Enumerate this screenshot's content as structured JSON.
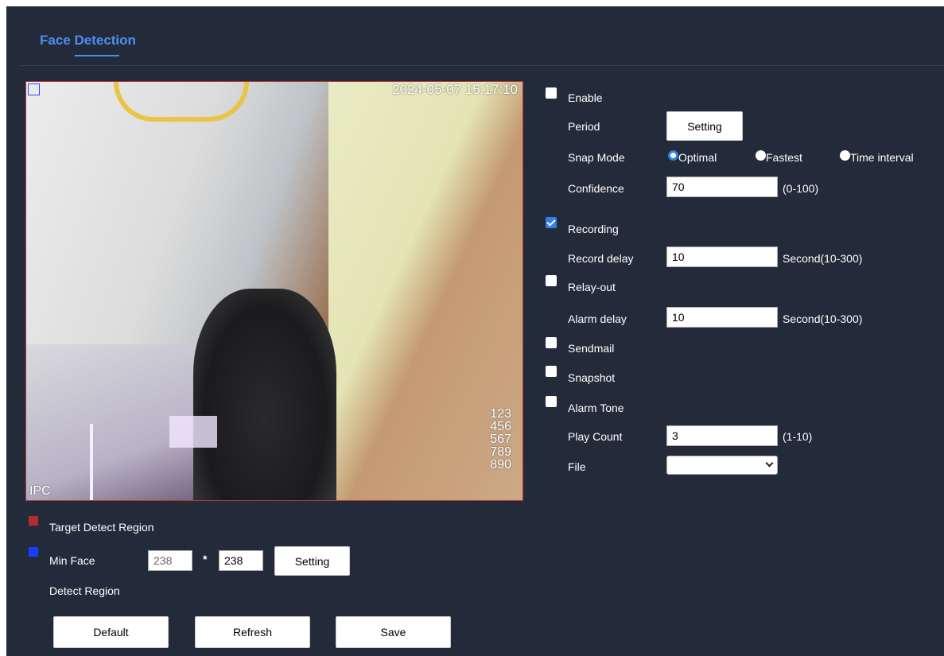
{
  "tab": {
    "label": "Face Detection"
  },
  "video": {
    "timestamp": "2024-05-07 15:17:10",
    "osd_lines": [
      "123",
      "456",
      "567",
      "789",
      "890"
    ],
    "channel_label": "IPC"
  },
  "legend": {
    "target_label": "Target Detect Region",
    "target_color": "#b32d2d",
    "min_face_color": "#1a3cff",
    "min_face_label": "Min Face",
    "detect_region_label": "Detect Region",
    "min_face_width": "238",
    "separator": "*",
    "min_face_height": "238",
    "setting_label": "Setting"
  },
  "footer": {
    "default_label": "Default",
    "refresh_label": "Refresh",
    "save_label": "Save"
  },
  "settings": {
    "enable": {
      "label": "Enable",
      "checked": false
    },
    "period": {
      "label": "Period",
      "button": "Setting"
    },
    "snap_mode": {
      "label": "Snap Mode",
      "options": [
        "Optimal",
        "Fastest",
        "Time interval"
      ],
      "selected": "Optimal"
    },
    "confidence": {
      "label": "Confidence",
      "value": "70",
      "range": "(0-100)"
    },
    "recording": {
      "label": "Recording",
      "checked": true
    },
    "record_delay": {
      "label": "Record delay",
      "value": "10",
      "unit": "Second(10-300)"
    },
    "relay_out": {
      "label": "Relay-out",
      "checked": false
    },
    "alarm_delay": {
      "label": "Alarm delay",
      "value": "10",
      "unit": "Second(10-300)"
    },
    "sendmail": {
      "label": "Sendmail",
      "checked": false
    },
    "snapshot": {
      "label": "Snapshot",
      "checked": false
    },
    "alarm_tone": {
      "label": "Alarm Tone",
      "checked": false
    },
    "play_count": {
      "label": "Play Count",
      "value": "3",
      "range": "(1-10)"
    },
    "file": {
      "label": "File",
      "value": ""
    }
  },
  "colors": {
    "accent": "#4f8ff0",
    "panel_bg": "#232a3a",
    "check_blue": "#2f7fe8"
  }
}
